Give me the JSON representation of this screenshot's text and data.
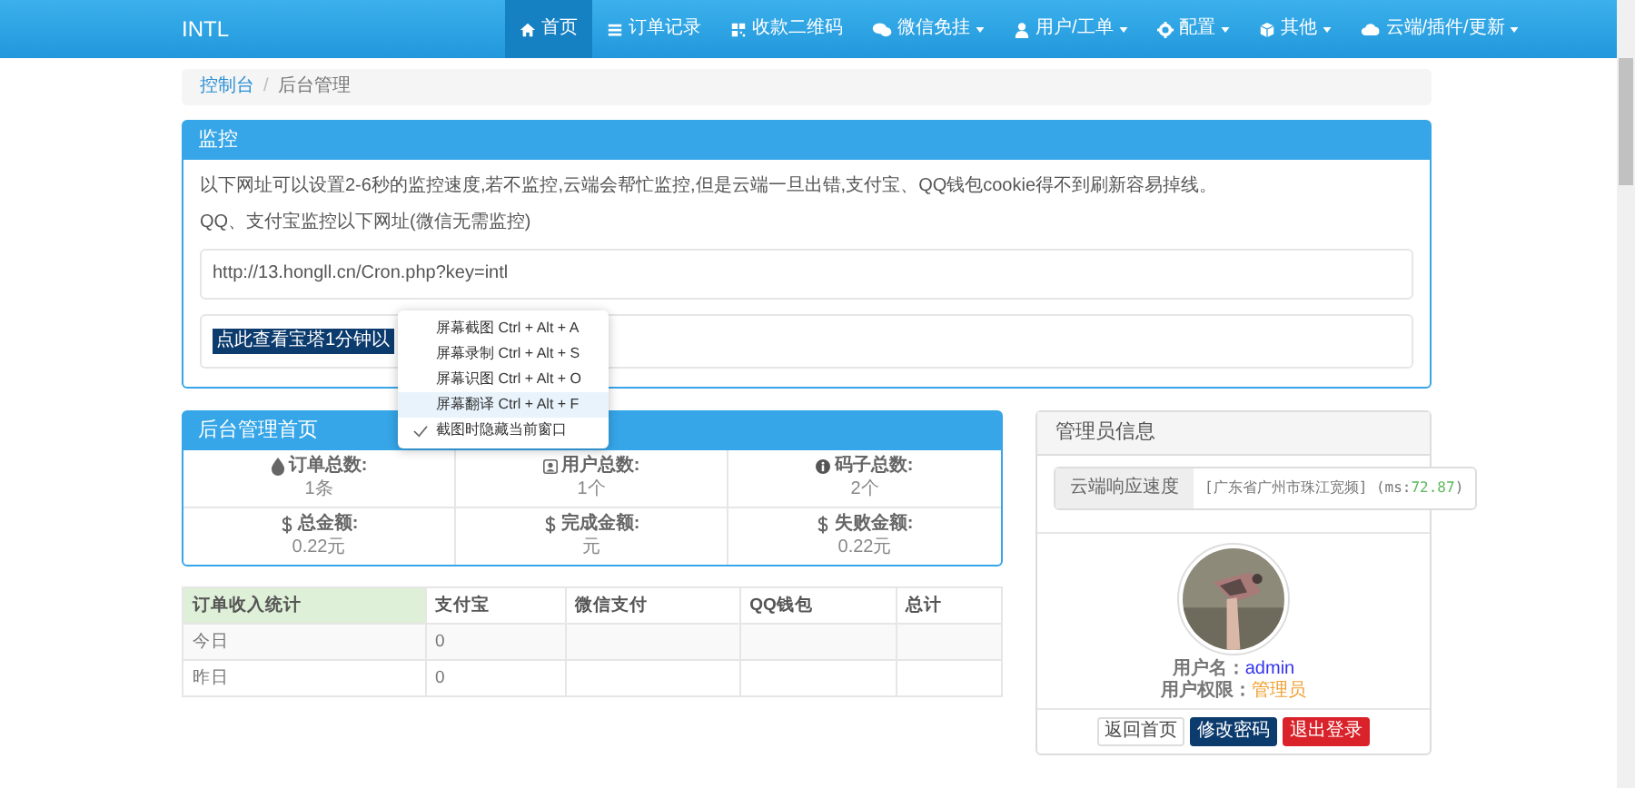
{
  "navbar": {
    "brand": "INTL",
    "items": [
      {
        "label": "首页",
        "kind": "home",
        "selected": true,
        "dropdown": false
      },
      {
        "label": "订单记录",
        "kind": "list",
        "selected": false,
        "dropdown": false
      },
      {
        "label": "收款二维码",
        "kind": "qrcode",
        "selected": false,
        "dropdown": false
      },
      {
        "label": "微信免挂",
        "kind": "chat",
        "selected": false,
        "dropdown": true
      },
      {
        "label": "用户/工单",
        "kind": "user",
        "selected": false,
        "dropdown": true
      },
      {
        "label": "配置",
        "kind": "gear",
        "selected": false,
        "dropdown": true
      },
      {
        "label": "其他",
        "kind": "cube",
        "selected": false,
        "dropdown": true
      },
      {
        "label": "云端/插件/更新",
        "kind": "cloud",
        "selected": false,
        "dropdown": true
      }
    ]
  },
  "breadcrumb": {
    "link": "控制台",
    "separator": "/",
    "current": "后台管理"
  },
  "monitor": {
    "title": "监控",
    "notice": "以下网址可以设置2-6秒的监控速度,若不监控,云端会帮忙监控,但是云端一旦出错,支付宝、QQ钱包cookie得不到刷新容易掉线。",
    "subtitle": "QQ、支付宝监控以下网址(微信无需监控)",
    "url": "http://13.hongll.cn/Cron.php?key=intl",
    "button": "点此查看宝塔1分钟以"
  },
  "context_menu": {
    "items": [
      {
        "label": "屏幕截图 Ctrl + Alt + A",
        "checked": false,
        "highlighted": false
      },
      {
        "label": "屏幕录制 Ctrl + Alt + S",
        "checked": false,
        "highlighted": false
      },
      {
        "label": "屏幕识图 Ctrl + Alt + O",
        "checked": false,
        "highlighted": false
      },
      {
        "label": "屏幕翻译 Ctrl + Alt + F",
        "checked": false,
        "highlighted": true
      },
      {
        "label": "截图时隐藏当前窗口",
        "checked": true,
        "highlighted": false
      }
    ]
  },
  "admin_home": {
    "title": "后台管理首页",
    "stats": [
      {
        "kind": "drop",
        "label": "订单总数:",
        "value": "1条"
      },
      {
        "kind": "user",
        "label": "用户总数:",
        "value": "1个"
      },
      {
        "kind": "info",
        "label": "码子总数:",
        "value": "2个"
      },
      {
        "kind": "dollar",
        "label": "总金额:",
        "value": "0.22元"
      },
      {
        "kind": "dollar",
        "label": "完成金额:",
        "value": "元"
      },
      {
        "kind": "dollar",
        "label": "失败金额:",
        "value": "0.22元"
      }
    ]
  },
  "income_table": {
    "columns": [
      "订单收入统计",
      "支付宝",
      "微信支付",
      "QQ钱包",
      "总计"
    ],
    "rows": [
      [
        "今日",
        "0"
      ],
      [
        "昨日",
        "0"
      ]
    ]
  },
  "admin_info": {
    "title": "管理员信息",
    "speed_label": "云端响应速度",
    "speed_location": "[广东省广州市珠江宽频]",
    "speed_ms_label": "(ms:",
    "speed_ms": "72.87",
    "speed_close": ")",
    "username_label": "用户名：",
    "username": "admin",
    "role_label": "用户权限：",
    "role": "管理员",
    "buttons": [
      {
        "label": "返回首页",
        "kind": "default"
      },
      {
        "label": "修改密码",
        "kind": "primary"
      },
      {
        "label": "退出登录",
        "kind": "danger"
      }
    ]
  }
}
